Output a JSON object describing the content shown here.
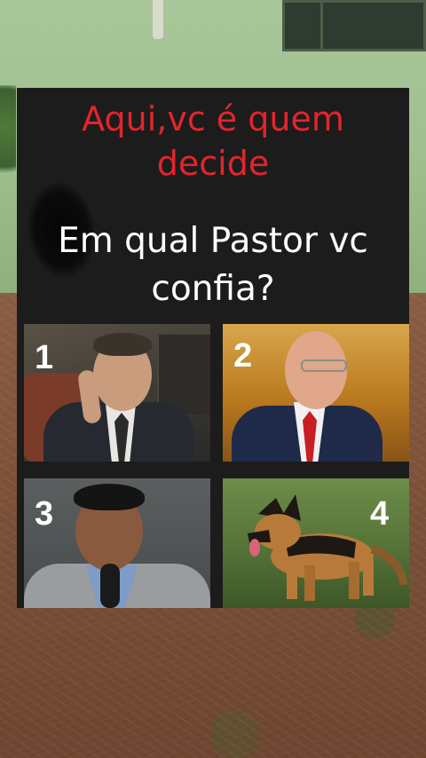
{
  "headline_lines": [
    "Aqui,vc é quem",
    "decide"
  ],
  "question_lines": [
    "Em qual Pastor vc",
    "confia?"
  ],
  "options": [
    {
      "number": "1",
      "subject": "man-in-dark-suit"
    },
    {
      "number": "2",
      "subject": "bald-man-with-red-tie"
    },
    {
      "number": "3",
      "subject": "man-with-microphone"
    },
    {
      "number": "4",
      "subject": "german-shepherd-dog"
    }
  ],
  "colors": {
    "headline": "#e3252b",
    "question": "#ffffff",
    "card_background": "#1c1c1c"
  }
}
